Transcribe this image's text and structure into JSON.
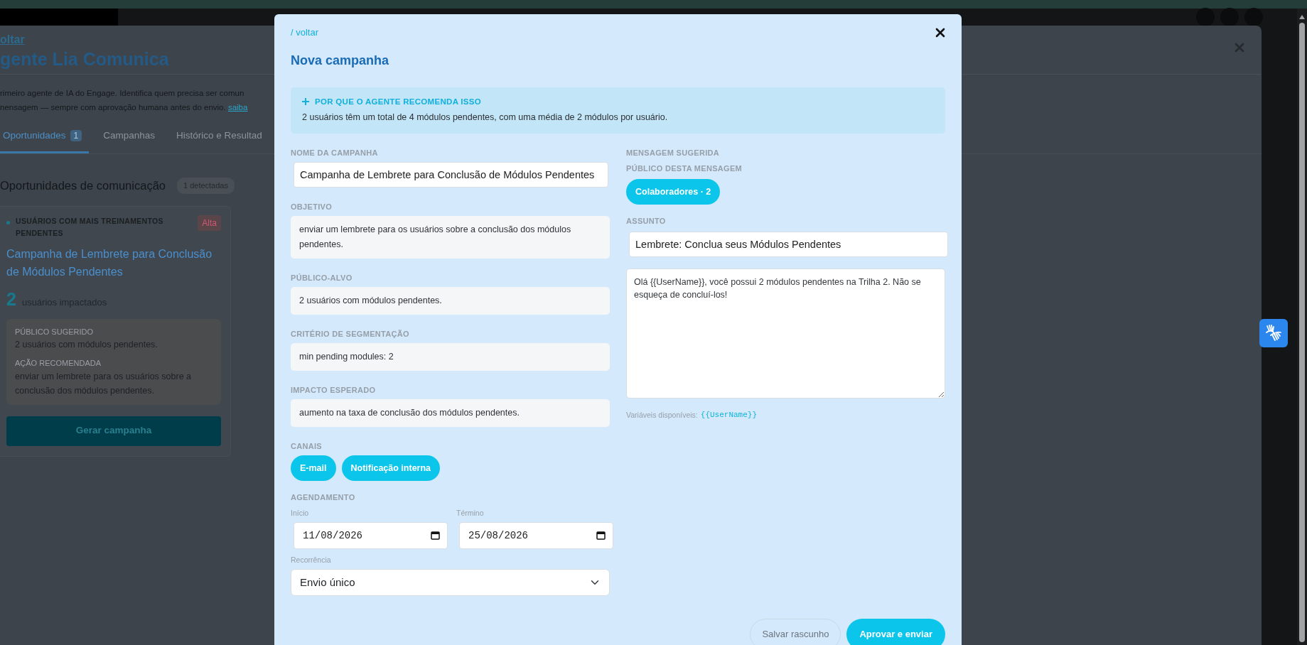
{
  "background_page": {
    "back_link": "oltar",
    "title": "gente Lia Comunica",
    "description_lines": [
      "rimeiro agente de IA do Engage. Identifica quem precisa ser comun",
      "nensagem — sempre com aprovação humana antes do envio."
    ],
    "description_link": "saiba",
    "tabs": [
      {
        "label": "Oportunidades",
        "count": "1",
        "selected": true
      },
      {
        "label": "Campanhas",
        "selected": false
      },
      {
        "label": "Histórico e Resultad",
        "selected": false
      }
    ],
    "section_title": "Oportunidades de comunicação",
    "section_badge": "1 detectadas",
    "opportunity": {
      "category": "USUÁRIOS COM MAIS TREINAMENTOS PENDENTES",
      "priority": "Alta",
      "title": "Campanha de Lembrete para Conclusão de Módulos Pendentes",
      "impact_count": "2",
      "impact_label": "usuários impactados",
      "details": [
        {
          "label": "PÚBLICO SUGERIDO",
          "value": "2 usuários com módulos pendentes."
        },
        {
          "label": "AÇÃO RECOMENDADA",
          "value": "enviar um lembrete para os usuários sobre a conclusão dos módulos pendentes."
        }
      ],
      "button": "Gerar campanha"
    }
  },
  "modal": {
    "back_link": "/ voltar",
    "title": "Nova campanha",
    "info": {
      "title": "POR QUE O AGENTE RECOMENDA ISSO",
      "text": "2 usuários têm um total de 4 módulos pendentes, com uma média de 2 módulos por usuário."
    },
    "campaign_name": {
      "label": "NOME DA CAMPANHA",
      "value": "Campanha de Lembrete para Conclusão de Módulos Pendentes"
    },
    "readonly_fields": [
      {
        "label": "OBJETIVO",
        "value": "enviar um lembrete para os usuários sobre a conclusão dos módulos pendentes."
      },
      {
        "label": "PÚBLICO-ALVO",
        "value": "2 usuários com módulos pendentes."
      },
      {
        "label": "CRITÉRIO DE SEGMENTAÇÃO",
        "value": "min pending modules: 2"
      },
      {
        "label": "IMPACTO ESPERADO",
        "value": "aumento na taxa de conclusão dos módulos pendentes."
      }
    ],
    "channels": {
      "label": "CANAIS",
      "options": [
        {
          "label": "E-mail",
          "selected": true
        },
        {
          "label": "Notificação interna",
          "selected": true
        }
      ]
    },
    "schedule": {
      "label": "AGENDAMENTO",
      "start": {
        "label": "Início",
        "value": "11/08/2026"
      },
      "end": {
        "label": "Término",
        "value": "25/08/2026"
      },
      "recurrence": {
        "label": "Recorrência",
        "value": "Envio único"
      }
    },
    "message": {
      "label": "MENSAGEM SUGERIDA",
      "audience_label": "PÚBLICO DESTA MENSAGEM",
      "audiences": [
        {
          "label": "Colaboradores · 2",
          "selected": true
        }
      ],
      "subject_label": "ASSUNTO",
      "subject": "Lembrete: Conclua seus Módulos Pendentes",
      "body": "Olá {{UserName}}, você possui 2 módulos pendentes na Trilha 2. Não se esqueça de concluí-los!",
      "variables_label": "Variáveis disponíveis:",
      "variables": [
        "{{UserName}}"
      ]
    },
    "buttons": [
      {
        "label": "Salvar rascunho",
        "kind": "secondary"
      },
      {
        "label": "Aprovar e enviar",
        "kind": "primary"
      }
    ]
  }
}
